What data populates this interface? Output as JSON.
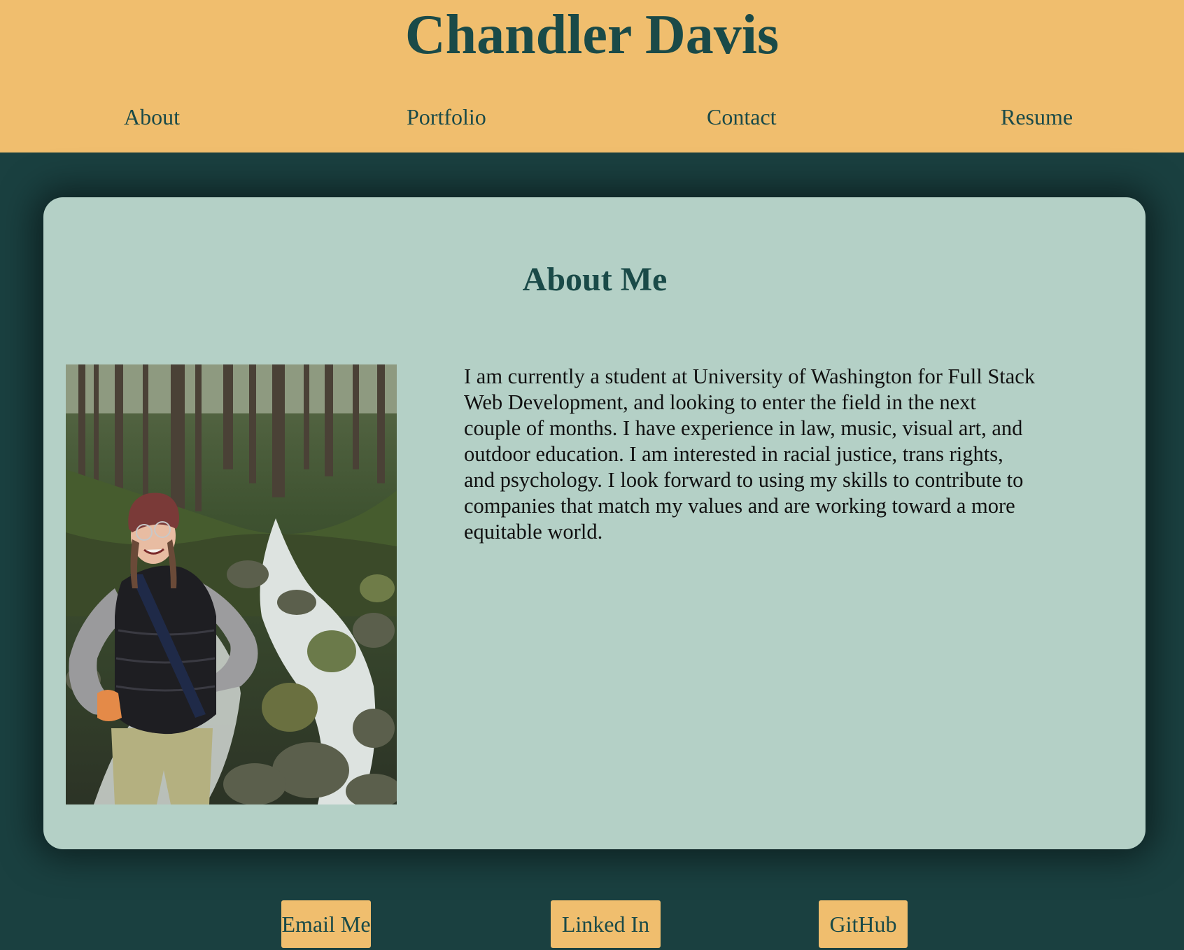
{
  "header": {
    "title": "Chandler Davis",
    "nav": [
      {
        "label": "About"
      },
      {
        "label": "Portfolio"
      },
      {
        "label": "Contact"
      },
      {
        "label": "Resume"
      }
    ]
  },
  "about": {
    "heading": "About Me",
    "paragraph": "I am currently a student at University of Washington for Full Stack Web Development, and looking to enter the field in the next couple of months. I have experience in law, music, visual art, and outdoor education. I am interested in racial justice, trans rights, and psychology. I look forward to using my skills to contribute to companies that match my values and are working toward a more equitable world."
  },
  "footer": {
    "buttons": [
      {
        "label": "Email Me"
      },
      {
        "label": "Linked In"
      },
      {
        "label": "GitHub"
      }
    ]
  },
  "colors": {
    "header_bg": "#f0be6e",
    "page_bg": "#1a4040",
    "card_bg": "#b4d0c6",
    "accent_text": "#1a4a48"
  }
}
